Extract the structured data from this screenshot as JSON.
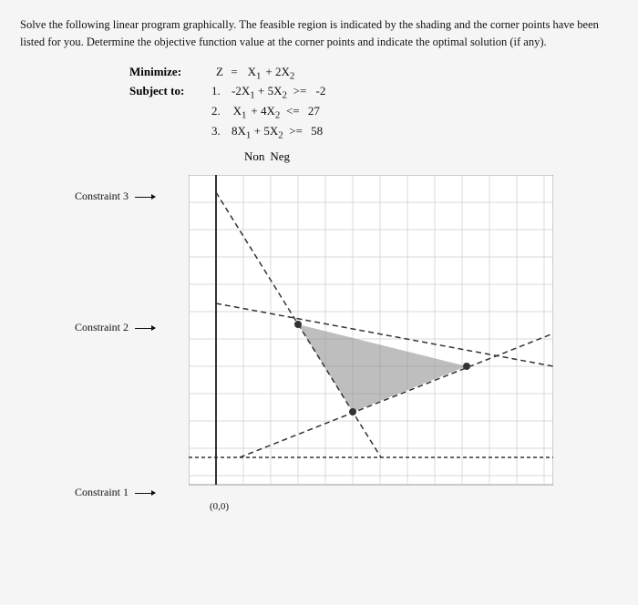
{
  "intro": {
    "text": "Solve the following linear program graphically. The feasible region is indicated by the shading and the corner points have been listed for you. Determine the objective function value at the corner points and indicate the optimal solution (if any)."
  },
  "lp": {
    "minimize_label": "Minimize:",
    "subject_label": "Subject to:",
    "objective": "Z =   X₁  +  2X₂",
    "constraints": [
      {
        "num": "1.",
        "expr": "-2X₁  +  5X₂  >=  -2"
      },
      {
        "num": "2.",
        "expr": "X₁  +  4X₂  <=  27"
      },
      {
        "num": "3.",
        "expr": "8X₁  +  5X₂  >=  58"
      }
    ],
    "non_neg": "Non   Neg"
  },
  "graph": {
    "constraint_labels": [
      {
        "id": "c3",
        "text": "Constraint 3"
      },
      {
        "id": "c2",
        "text": "Constraint 2"
      },
      {
        "id": "c1",
        "text": "Constraint 1"
      }
    ],
    "origin_label": "(0,0)"
  }
}
